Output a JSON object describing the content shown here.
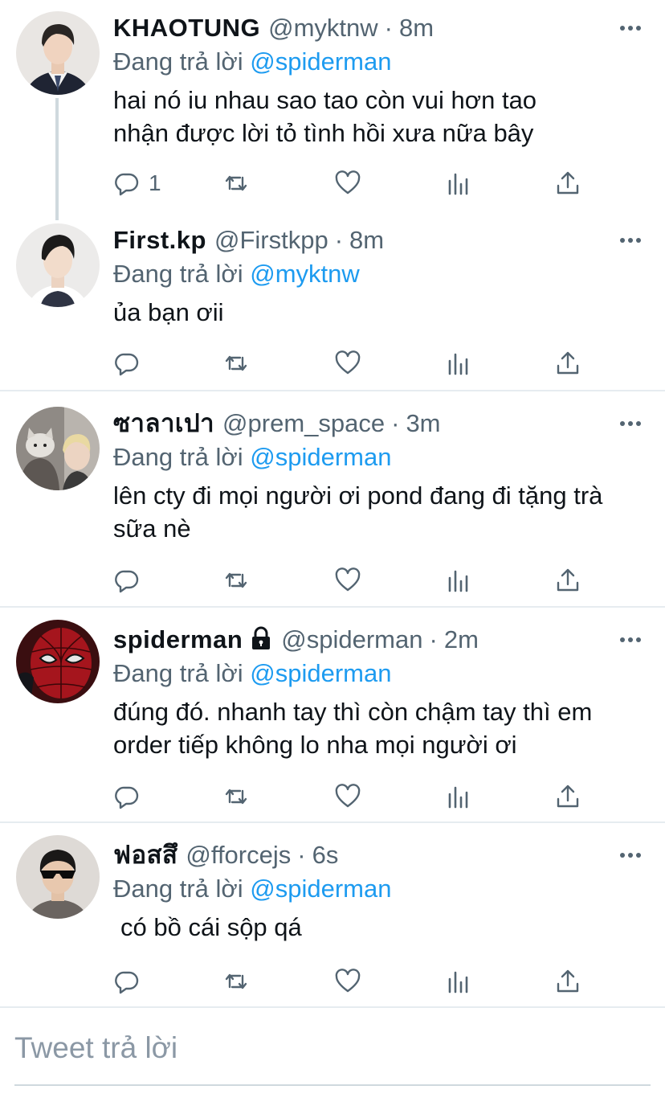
{
  "reply_prefix": "Đang trả lời",
  "tweets": [
    {
      "name": "KHAOTUNG",
      "handle": "@myktnw",
      "time": "8m",
      "reply_to": "@spiderman",
      "text": "hai nó iu nhau sao tao còn vui hơn tao nhận được lời tỏ tình hồi xưa nữa bây",
      "reply_count": "1",
      "avatar": "person-avatar",
      "locked": false
    },
    {
      "name": "First.kp",
      "handle": "@Firstkpp",
      "time": "8m",
      "reply_to": "@myktnw",
      "text": "ủa bạn ơii",
      "reply_count": "",
      "avatar": "person-avatar",
      "locked": false
    },
    {
      "name": "ซาลาเปา",
      "handle": "@prem_space",
      "time": "3m",
      "reply_to": "@spiderman",
      "text": "lên cty đi mọi người ơi pond đang đi tặng trà sữa nè",
      "reply_count": "",
      "avatar": "cat-and-person-avatar",
      "locked": false
    },
    {
      "name": "spiderman",
      "handle": "@spiderman",
      "time": "2m",
      "reply_to": "@spiderman",
      "text": "đúng đó. nhanh tay thì còn chậm tay thì em order tiếp không lo nha mọi người ơi",
      "reply_count": "",
      "avatar": "spiderman-mask-avatar",
      "locked": true
    },
    {
      "name": "ฟอสสึ",
      "handle": "@fforcejs",
      "time": "6s",
      "reply_to": "@spiderman",
      "text": "có bồ cái sộp qá",
      "reply_count": "",
      "avatar": "sunglasses-person-avatar",
      "locked": false
    }
  ],
  "composer": {
    "placeholder": "Tweet trả lời"
  },
  "colors": {
    "link": "#1d9bf0",
    "secondary": "#536471",
    "divider": "#e6ecf0"
  }
}
